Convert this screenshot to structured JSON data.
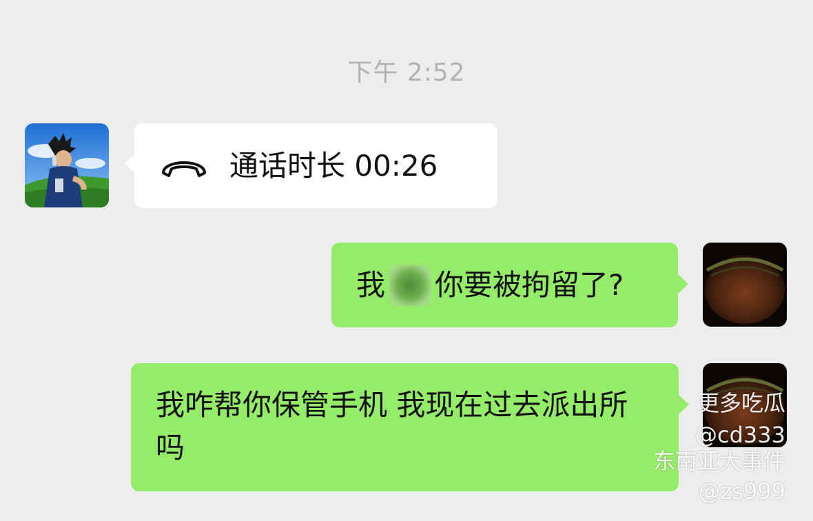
{
  "timestamp": "下午 2:52",
  "messages": [
    {
      "side": "left",
      "type": "call",
      "icon": "phone-hangup-icon",
      "text": "通话时长 00:26"
    },
    {
      "side": "right",
      "type": "text",
      "text_before": "我",
      "text_after": "你要被拘留了?"
    },
    {
      "side": "right",
      "type": "text",
      "text": "我咋帮你保管手机 我现在过去派出所吗"
    }
  ],
  "watermark": {
    "line1": "更多吃瓜",
    "line2": "@cd333",
    "line3": "东南亚大事件",
    "line4": "@zs999"
  },
  "colors": {
    "background": "#ededed",
    "incoming_bubble": "#ffffff",
    "outgoing_bubble": "#95ec69",
    "timestamp": "#b2b2b2"
  }
}
